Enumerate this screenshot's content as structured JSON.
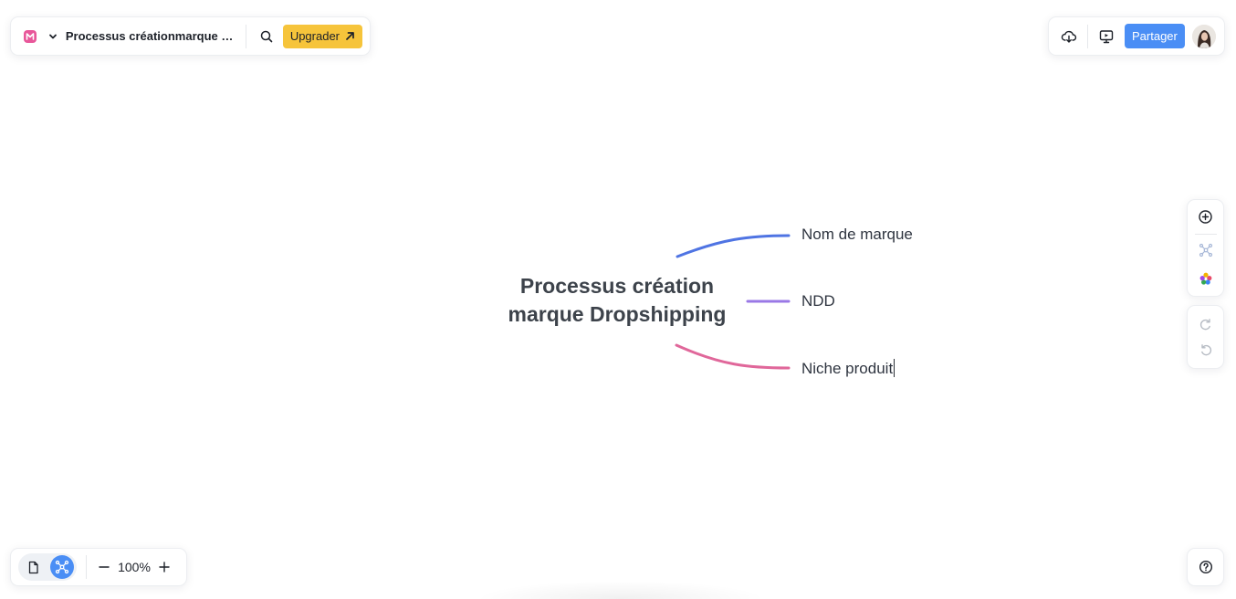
{
  "app": {
    "brand_color": "#e8579a",
    "accent_color": "#4a8ef5",
    "upgrade_color": "#f6c43b"
  },
  "toolbar": {
    "doc_title": "Processus créationmarque Dr...",
    "upgrade_label": "Upgrader",
    "share_label": "Partager",
    "icons": [
      "logo-icon",
      "chevron-down-icon",
      "search-icon",
      "arrow-up-right-icon",
      "cloud-download-icon",
      "present-icon",
      "avatar"
    ]
  },
  "side_toolbar": {
    "icons": [
      "add-circle-icon",
      "mindmap-icon",
      "palette-icon",
      "redo-icon",
      "undo-icon"
    ]
  },
  "zoom": {
    "level": "100%",
    "minus": "—",
    "plus": "+"
  },
  "mindmap": {
    "central": "Processus création marque Dropshipping",
    "branches": [
      {
        "label": "Nom de marque",
        "color": "#4f74e3"
      },
      {
        "label": "NDD",
        "color": "#9a78e6"
      },
      {
        "label": "Niche produit",
        "color": "#e0679a"
      }
    ]
  }
}
